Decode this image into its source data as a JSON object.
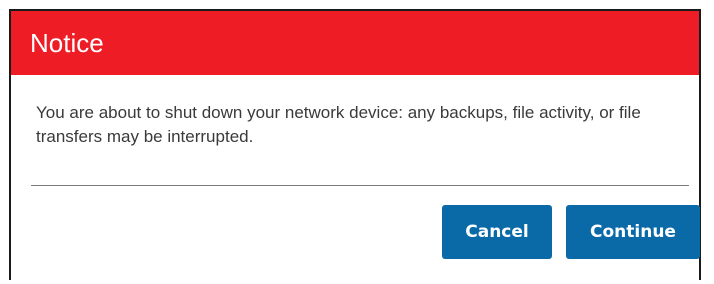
{
  "dialog": {
    "title": "Notice",
    "message": "You are about to shut down your network device: any backups, file activity, or file transfers may be interrupted.",
    "buttons": {
      "cancel_label": "Cancel",
      "continue_label": "Continue"
    }
  },
  "colors": {
    "header_background": "#ee1c25",
    "button_background": "#0a6aa8",
    "text": "#3a3a3a"
  }
}
